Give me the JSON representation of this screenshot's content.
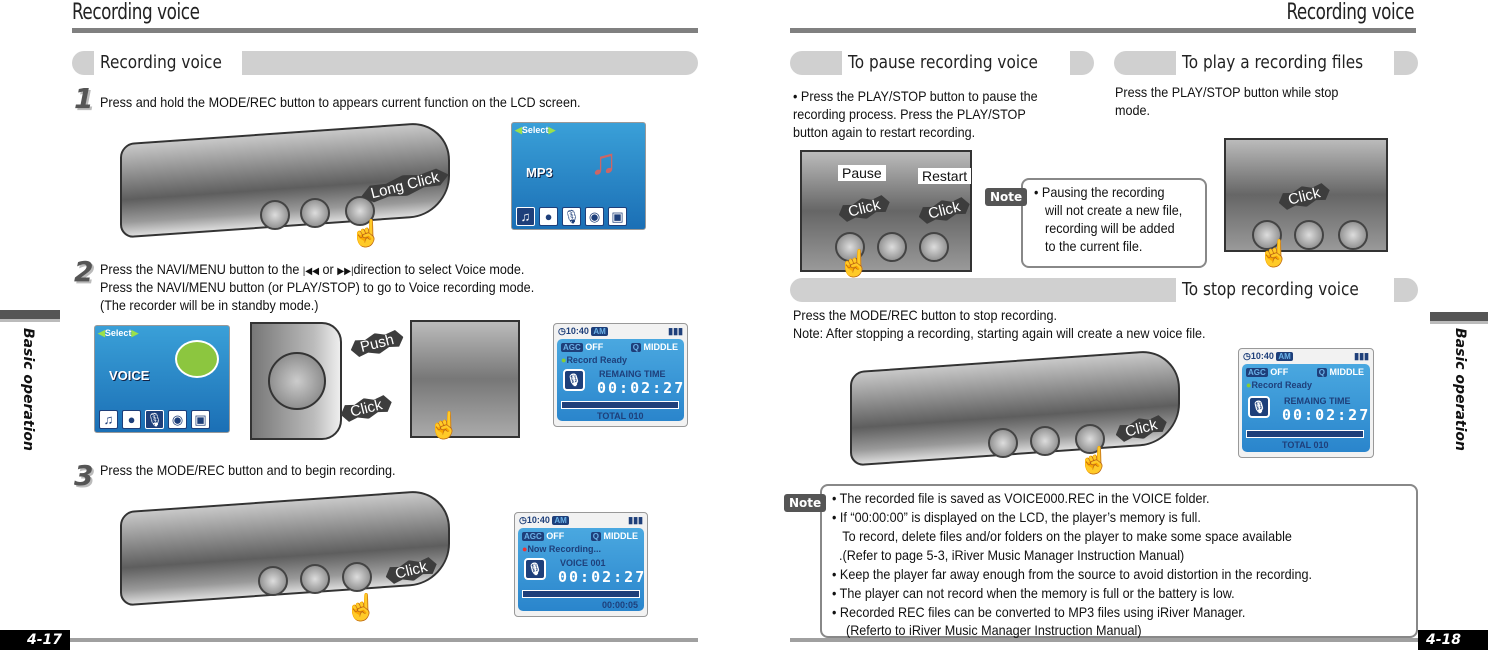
{
  "left_page": {
    "title": "Recording voice",
    "section_label": "Recording voice",
    "side_label": "Basic operation",
    "page_number": "4-17",
    "steps": [
      {
        "num": "1",
        "lines": [
          "Press and hold the MODE/REC button to appears current function on the LCD screen."
        ]
      },
      {
        "num": "2",
        "lines": [
          "Press the NAVI/MENU button to the",
          "or",
          "direction to select Voice mode.",
          "Press the NAVI/MENU button (or PLAY/STOP) to go to Voice recording mode.",
          " (The recorder will be in standby mode.)"
        ]
      },
      {
        "num": "3",
        "lines": [
          "Press the MODE/REC button and to begin recording."
        ]
      }
    ],
    "callouts": {
      "long_click": "Long Click",
      "push": "Push",
      "click": "Click"
    },
    "lcd_mp3": {
      "select": "Select",
      "mode": "MP3"
    },
    "lcd_voice": {
      "select": "Select",
      "mode": "VOICE"
    },
    "lcd_ready": {
      "time": "10:40",
      "ampm": "AM",
      "agc": "AGC",
      "agc_state": "OFF",
      "quality_icon": "Q",
      "quality": "MIDDLE",
      "status": "Record Ready",
      "label": "REMAING TIME",
      "digits": "00:02:27",
      "footer": "TOTAL 010"
    },
    "lcd_recording": {
      "time": "10:40",
      "ampm": "AM",
      "agc": "AGC",
      "agc_state": "OFF",
      "quality_icon": "Q",
      "quality": "MIDDLE",
      "status": "Now Recording...",
      "label": "VOICE 001",
      "digits": "00:02:27",
      "footer": "00:00:05"
    }
  },
  "right_page": {
    "title": "Recording voice",
    "side_label": "Basic operation",
    "page_number": "4-18",
    "pause": {
      "heading": "To pause recording voice",
      "lines": [
        "• Press the PLAY/STOP button to pause the",
        "recording process.  Press the PLAY/STOP",
        "button again to restart recording."
      ],
      "pause_label": "Pause",
      "restart_label": "Restart",
      "click": "Click",
      "note_tag": "Note",
      "note_lines": [
        "•  Pausing the recording",
        "will not create a new file,",
        "recording will be added",
        "to the current file."
      ]
    },
    "play": {
      "heading": "To play a recording files",
      "lines": [
        "Press the PLAY/STOP button while stop",
        "mode."
      ],
      "click": "Click"
    },
    "stop": {
      "heading": "To stop recording voice",
      "lines": [
        "Press the MODE/REC button to stop recording.",
        "Note: After stopping a recording, starting again will create a new voice file."
      ],
      "click": "Click",
      "lcd": {
        "time": "10:40",
        "ampm": "AM",
        "agc": "AGC",
        "agc_state": "OFF",
        "quality_icon": "Q",
        "quality": "MIDDLE",
        "status": "Record Ready",
        "label": "REMAING TIME",
        "digits": "00:02:27",
        "footer": "TOTAL 010"
      }
    },
    "note": {
      "tag": "Note",
      "lines": [
        "• The recorded file is saved as VOICE000.REC in the VOICE folder.",
        "• If “00:00:00” is displayed on the LCD, the player’s memory is full.",
        "   To record, delete files and/or folders on the player to make some space available",
        "  .(Refer to page 5-3, iRiver Music Manager Instruction Manual)",
        "• Keep the player far away enough from the source to avoid distortion in the recording.",
        "• The player can not record when the memory is full or the battery is low.",
        "• Recorded REC files can be converted to MP3 files using iRiver Manager.",
        "    (Referto to iRiver Music Manager Instruction Manual)"
      ]
    }
  }
}
